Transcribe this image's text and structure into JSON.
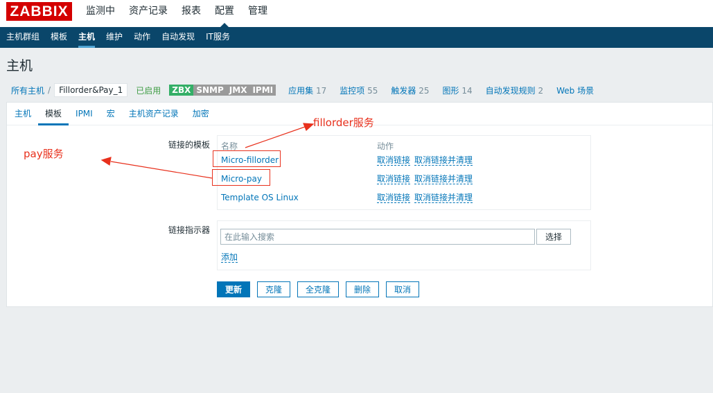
{
  "logo": "ZABBIX",
  "main_nav": [
    "监测中",
    "资产记录",
    "报表",
    "配置",
    "管理"
  ],
  "main_nav_active": "配置",
  "sub_nav": [
    "主机群组",
    "模板",
    "主机",
    "维护",
    "动作",
    "自动发现",
    "IT服务"
  ],
  "sub_nav_active": "主机",
  "page_title": "主机",
  "host_bar": {
    "all_hosts": "所有主机",
    "separator": "/",
    "host_name": "Fillorder&Pay_1",
    "status": "已启用",
    "availability": [
      "ZBX",
      "SNMP",
      "JMX",
      "IPMI"
    ],
    "links": [
      {
        "label": "应用集",
        "count": "17"
      },
      {
        "label": "监控项",
        "count": "55"
      },
      {
        "label": "触发器",
        "count": "25"
      },
      {
        "label": "图形",
        "count": "14"
      },
      {
        "label": "自动发现规则",
        "count": "2"
      },
      {
        "label": "Web 场景",
        "count": ""
      }
    ]
  },
  "tabs": [
    "主机",
    "模板",
    "IPMI",
    "宏",
    "主机资产记录",
    "加密"
  ],
  "tabs_active": "模板",
  "linked_templates": {
    "label": "链接的模板",
    "col_name": "名称",
    "col_action": "动作",
    "rows": [
      {
        "name": "Micro-fillorder",
        "unlink": "取消链接",
        "unlink_clear": "取消链接并清理"
      },
      {
        "name": "Micro-pay",
        "unlink": "取消链接",
        "unlink_clear": "取消链接并清理"
      },
      {
        "name": "Template OS Linux",
        "unlink": "取消链接",
        "unlink_clear": "取消链接并清理"
      }
    ]
  },
  "link_new": {
    "label": "链接指示器",
    "placeholder": "在此输入搜索",
    "select_label": "选择",
    "add_label": "添加"
  },
  "buttons": {
    "update": "更新",
    "clone": "克隆",
    "full_clone": "全克隆",
    "delete": "删除",
    "cancel": "取消"
  },
  "annotations": {
    "fillorder": "fillorder服务",
    "pay": "pay服务"
  }
}
